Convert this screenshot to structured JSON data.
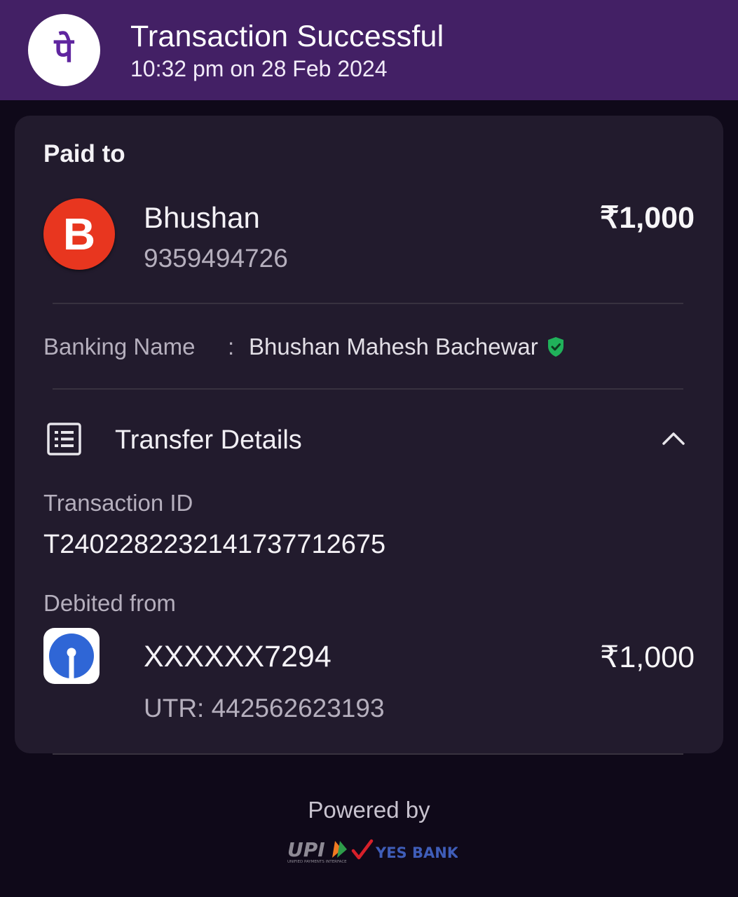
{
  "header": {
    "title": "Transaction Successful",
    "timestamp": "10:32 pm on 28 Feb 2024",
    "logo_glyph": "पे",
    "logo_icon": "phonepe-logo-icon",
    "brand_color": "#432065"
  },
  "payee": {
    "section_label": "Paid to",
    "avatar_letter": "B",
    "avatar_color": "#e8361f",
    "name": "Bhushan",
    "phone": "9359494726",
    "amount": "₹1,000"
  },
  "banking": {
    "label": "Banking Name",
    "separator": ":",
    "value": "Bhushan Mahesh Bachewar",
    "verified_icon": "verified-shield-icon"
  },
  "transfer_details": {
    "title": "Transfer Details",
    "icon": "receipt-list-icon",
    "toggle_icon": "chevron-up-icon",
    "transaction_id_label": "Transaction ID",
    "transaction_id": "T2402282232141737712675",
    "debited_from_label": "Debited from",
    "bank_icon": "sbi-logo-icon",
    "account": "XXXXXX7294",
    "utr": "UTR: 442562623193",
    "amount": "₹1,000"
  },
  "footer": {
    "powered_by": "Powered by",
    "upi_text": "UPI",
    "upi_subtext": "UNIFIED PAYMENTS INTERFACE",
    "partner_bank": "YES BANK"
  }
}
